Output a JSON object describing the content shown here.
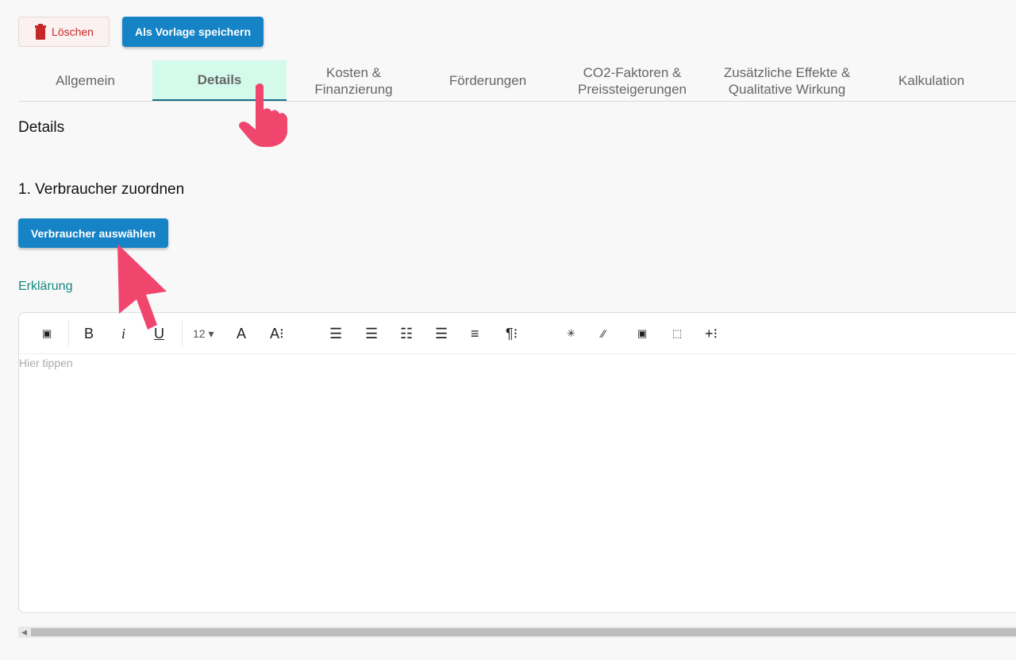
{
  "actions": {
    "delete_label": "Löschen",
    "save_template_label": "Als Vorlage speichern"
  },
  "tabs": [
    {
      "label": "Allgemein"
    },
    {
      "label": "Details"
    },
    {
      "label": "Kosten & Finanzierung"
    },
    {
      "label": "Förderungen"
    },
    {
      "label": "CO2-Faktoren & Preissteigerungen"
    },
    {
      "label": "Zusätzliche Effekte & Qualitative Wirkung"
    },
    {
      "label": "Kalkulation"
    }
  ],
  "main": {
    "title": "Details",
    "section_title": "1. Verbraucher zuordnen",
    "select_button": "Verbraucher auswählen",
    "explanation_label": "Erklärung"
  },
  "editor": {
    "font_size": "12",
    "placeholder": "Hier tippen"
  },
  "colors": {
    "primary": "#1583c6",
    "active_tab": "#d4faeb",
    "danger": "#c62828",
    "link": "#138a80"
  }
}
